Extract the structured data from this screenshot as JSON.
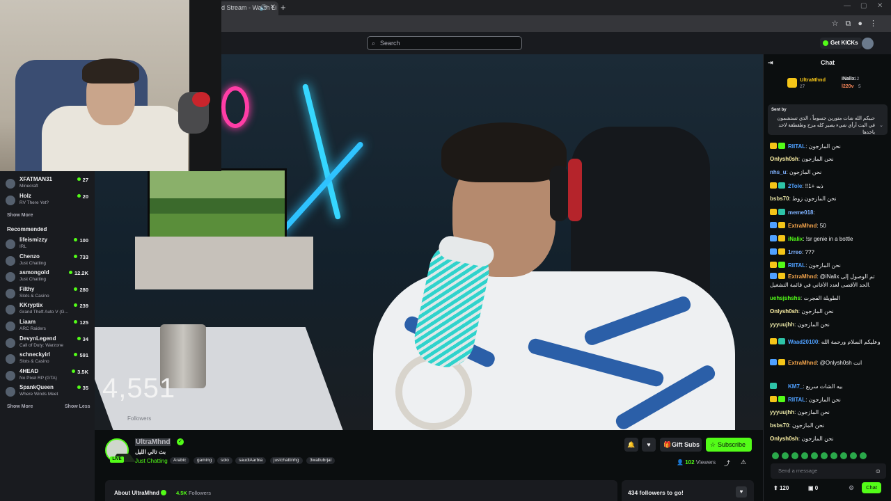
{
  "browser": {
    "tab_title": "d Stream - Watch Li",
    "new_tab": "+",
    "window_controls": [
      "—",
      "▢",
      "✕"
    ]
  },
  "header": {
    "search_placeholder": "Search",
    "get_kicks": "Get KICKs"
  },
  "sidebar": {
    "following": [
      {
        "name": "XFATMAN31",
        "category": "Minecraft",
        "viewers": "27"
      },
      {
        "name": "Holz",
        "category": "RV There Yet?",
        "viewers": "20"
      }
    ],
    "show_more_1": "Show More",
    "recommended_title": "Recommended",
    "recommended": [
      {
        "name": "lifeismizzy",
        "category": "IRL",
        "viewers": "100"
      },
      {
        "name": "Chenzo",
        "category": "Just Chatting",
        "viewers": "733"
      },
      {
        "name": "asmongold",
        "category": "Just Chatting",
        "viewers": "12.2K"
      },
      {
        "name": "Filthy",
        "category": "Slots & Casino",
        "viewers": "280"
      },
      {
        "name": "KKryptix",
        "category": "Grand Theft Auto V (G...",
        "viewers": "239"
      },
      {
        "name": "Liaam",
        "category": "ARC Raiders",
        "viewers": "125"
      },
      {
        "name": "DevynLegend",
        "category": "Call of Duty: Warzone",
        "viewers": "34"
      },
      {
        "name": "schneckyirl",
        "category": "Slots & Casino",
        "viewers": "591"
      },
      {
        "name": "4HEAD",
        "category": "No Pixel RP (GTA)",
        "viewers": "3.5K"
      },
      {
        "name": "SpankQueen",
        "category": "Where Winds Meet",
        "viewers": "35"
      }
    ],
    "show_more_2": "Show More",
    "show_less": "Show Less"
  },
  "video": {
    "follower_count": "4,551",
    "follower_label": "Followers"
  },
  "stream": {
    "channel": "UltraMhnd",
    "live_label": "LIVE",
    "title": "بث تالي الليل",
    "category": "Just Chatting",
    "tags": [
      "Arabic",
      "gaming",
      "solo",
      "saudiAarbia",
      "justchattinhg",
      "3waltubrjal"
    ],
    "gift_subs": "Gift Subs",
    "subscribe": "Subscribe",
    "viewers_count": "102",
    "viewers_label": "Viewers",
    "about": "About UltraMhnd",
    "followers_count": "4.5K",
    "followers_label": "Followers",
    "goal": "434 followers to go!"
  },
  "chat": {
    "title": "Chat",
    "leaderboard": {
      "first_name": "UltraMhnd",
      "first_value": "27",
      "second_name": "iNalix",
      "second_value": "12",
      "third_name": "l220v",
      "third_value": "5"
    },
    "pinned_label": "Sent by",
    "pinned_text": "حبيكم الله شات متورين جسوماً ، الذي تستشمون في البث أرأي شيء يصير كله مزح وطقطقة لاحد ياخذها",
    "messages": [
      {
        "user": "RIITAL",
        "color": "#4fa0ff",
        "text": "نحن المازجون",
        "badges": [
          "#f5c518",
          "#53fc18"
        ]
      },
      {
        "user": "Onlysh0sh",
        "color": "#fff3a6",
        "text": "نحن المازجون",
        "badges": []
      },
      {
        "user": "nhs_u",
        "color": "#7fb2ff",
        "text": "نحن المازجون",
        "badges": []
      },
      {
        "user": "2Tole",
        "color": "#4fa0ff",
        "text": "!!1+ ذبه",
        "badges": [
          "#f5c518",
          "#2ec4a8"
        ]
      },
      {
        "user": "bsbs70",
        "color": "#e8e5a5",
        "text": "نحن المازجون زوط",
        "badges": []
      },
      {
        "user": "meme018",
        "color": "#7fb2ff",
        "text": "",
        "badges": [
          "#f5c518",
          "#2ec4a8"
        ]
      },
      {
        "user": "ExtraMhnd",
        "color": "#f4a44b",
        "text": "50",
        "badges": [
          "#4fa0ff",
          "#f5c518"
        ]
      },
      {
        "user": "iNalix",
        "color": "#53fc18",
        "text": "!sr genie in a bottle",
        "badges": [
          "#4fa0ff",
          "#f5c518"
        ]
      },
      {
        "user": "1rreo",
        "color": "#7fb2ff",
        "text": "???",
        "badges": [
          "#4fa0ff",
          "#f5c518"
        ]
      },
      {
        "user": "RIITAL",
        "color": "#4fa0ff",
        "text": "نحن المازجون",
        "badges": [
          "#f5c518",
          "#53fc18"
        ]
      },
      {
        "user": "ExtraMhnd",
        "color": "#f4a44b",
        "text": "@iNalix تم الوصول إلى",
        "badges": [
          "#4fa0ff",
          "#f5c518"
        ]
      },
      {
        "user": "",
        "color": "#efeff1",
        "text": "الحد الأقصى لعدد الأغاني في قائمة التشغيل.",
        "badges": []
      },
      {
        "user": "uehsjshshs",
        "color": "#53fc18",
        "text": "الطويلة الفجرت",
        "badges": []
      },
      {
        "user": "Onlysh0sh",
        "color": "#fff3a6",
        "text": "نحن المازجون",
        "badges": []
      },
      {
        "user": "yyyuujhh",
        "color": "#e8e5a5",
        "text": "نحن المازجون",
        "badges": []
      },
      {
        "user": "Waad20100",
        "color": "#4fa0ff",
        "text": "وعليكم السلام ورحمة الله",
        "badges": [
          "#f5c518",
          "#2ec4a8"
        ]
      },
      {
        "user": "ExtraMhnd",
        "color": "#f4a44b",
        "text": "@Onlysh0sh انت",
        "badges": [
          "#4fa0ff",
          "#f5c518"
        ]
      },
      {
        "user": "KM7_",
        "color": "#4fa0ff",
        "text": "بيه الشات سريع",
        "badges": [
          "#2ec4a8"
        ]
      },
      {
        "user": "RIITAL",
        "color": "#4fa0ff",
        "text": "نحن المازجون",
        "badges": [
          "#f5c518",
          "#53fc18"
        ]
      },
      {
        "user": "yyyuujhh",
        "color": "#e8e5a5",
        "text": "نحن المازجون",
        "badges": []
      },
      {
        "user": "bsbs70",
        "color": "#e8e5a5",
        "text": "نحن المازجون",
        "badges": []
      },
      {
        "user": "Onlysh0sh",
        "color": "#fff3a6",
        "text": "نحن المازجون",
        "badges": []
      }
    ],
    "input_placeholder": "Send a message",
    "points": "120",
    "points2": "0",
    "chat_button": "Chat"
  }
}
